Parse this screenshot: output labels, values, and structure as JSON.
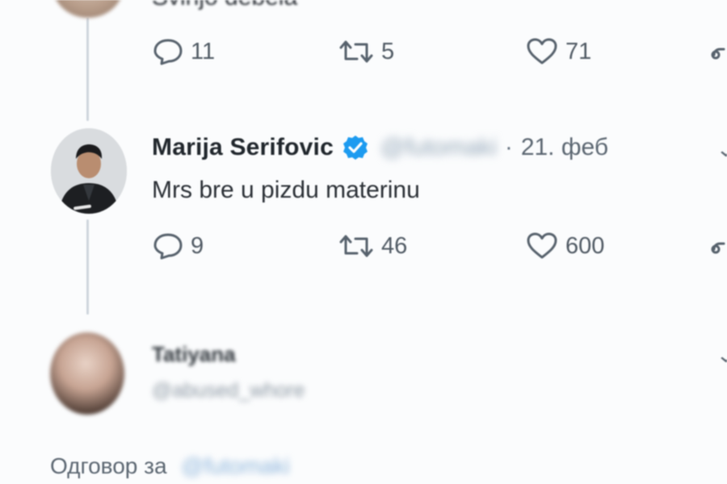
{
  "top_tweet": {
    "text": "Svinjo debela",
    "actions": {
      "reply_count": "11",
      "retweet_count": "5",
      "like_count": "71"
    }
  },
  "main_tweet": {
    "display_name": "Marija Serifovic",
    "handle": "@futomaki",
    "separator": "·",
    "date": "21. феб",
    "text": "Mrs bre u pizdu materinu",
    "actions": {
      "reply_count": "9",
      "retweet_count": "46",
      "like_count": "600"
    }
  },
  "reply_tweet": {
    "display_name": "Tatiyana",
    "handle": "@abused_whore",
    "reply_prefix": "Одговор за",
    "reply_to": "@futomaki"
  },
  "icons": {
    "reply": "speech-bubble-icon",
    "retweet": "retweet-arrows-icon",
    "like": "heart-icon",
    "share": "share-icon",
    "verified": "verified-badge-icon",
    "more": "chevron-down-icon"
  },
  "colors": {
    "verified": "#1d9bf0",
    "icon_gray": "#56616c",
    "mention_blue": "#8fb6dc",
    "background": "#fbfcfd"
  }
}
